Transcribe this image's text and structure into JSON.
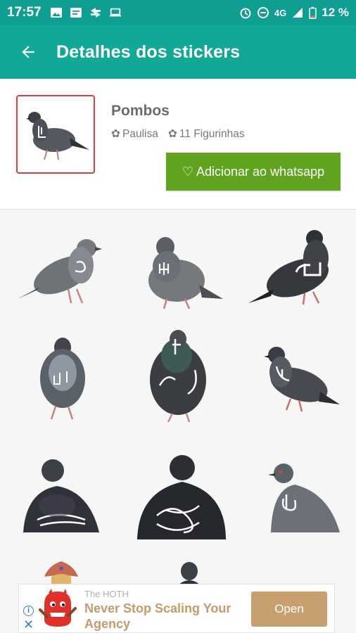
{
  "status_bar": {
    "time": "17:57",
    "network": "4G",
    "battery": "12 %",
    "left_icons": [
      "image-icon",
      "message-icon",
      "sync-icon",
      "laptop-icon"
    ],
    "right_icons": [
      "alarm-icon",
      "do-not-disturb-icon",
      "signal-icon",
      "battery-icon"
    ]
  },
  "app_bar": {
    "title": "Detalhes dos stickers",
    "back_icon": "arrow-back-icon",
    "color": "#12a898"
  },
  "pack": {
    "name": "Pombos",
    "author_icon": "✿",
    "author": "Paulisa",
    "count_icon": "✿",
    "count_label": "11 Figurinhas",
    "add_button_icon": "♡",
    "add_button_label": "Adicionar ao whatsapp",
    "button_color": "#5fa31f"
  },
  "stickers": [
    {
      "name": "pigeon-side-white-arm"
    },
    {
      "name": "pigeon-front-pointing"
    },
    {
      "name": "pigeon-dark-hands-wing"
    },
    {
      "name": "pigeon-front-standing"
    },
    {
      "name": "pigeon-greenneck-arms"
    },
    {
      "name": "pigeon-side-drawn-arms"
    },
    {
      "name": "pigeon-closeup-crossed-arms"
    },
    {
      "name": "pigeon-closeup-folded-arms"
    },
    {
      "name": "pigeon-redeye-finger"
    },
    {
      "name": "sticker-partial-ornament"
    },
    {
      "name": "pigeon-partial-head"
    }
  ],
  "ad": {
    "sponsor": "The HOTH",
    "headline": "Never Stop Scaling Your Agency",
    "button_label": "Open",
    "info_icon": "i",
    "close_icon": "✕",
    "accent_color": "#c8a06f"
  }
}
